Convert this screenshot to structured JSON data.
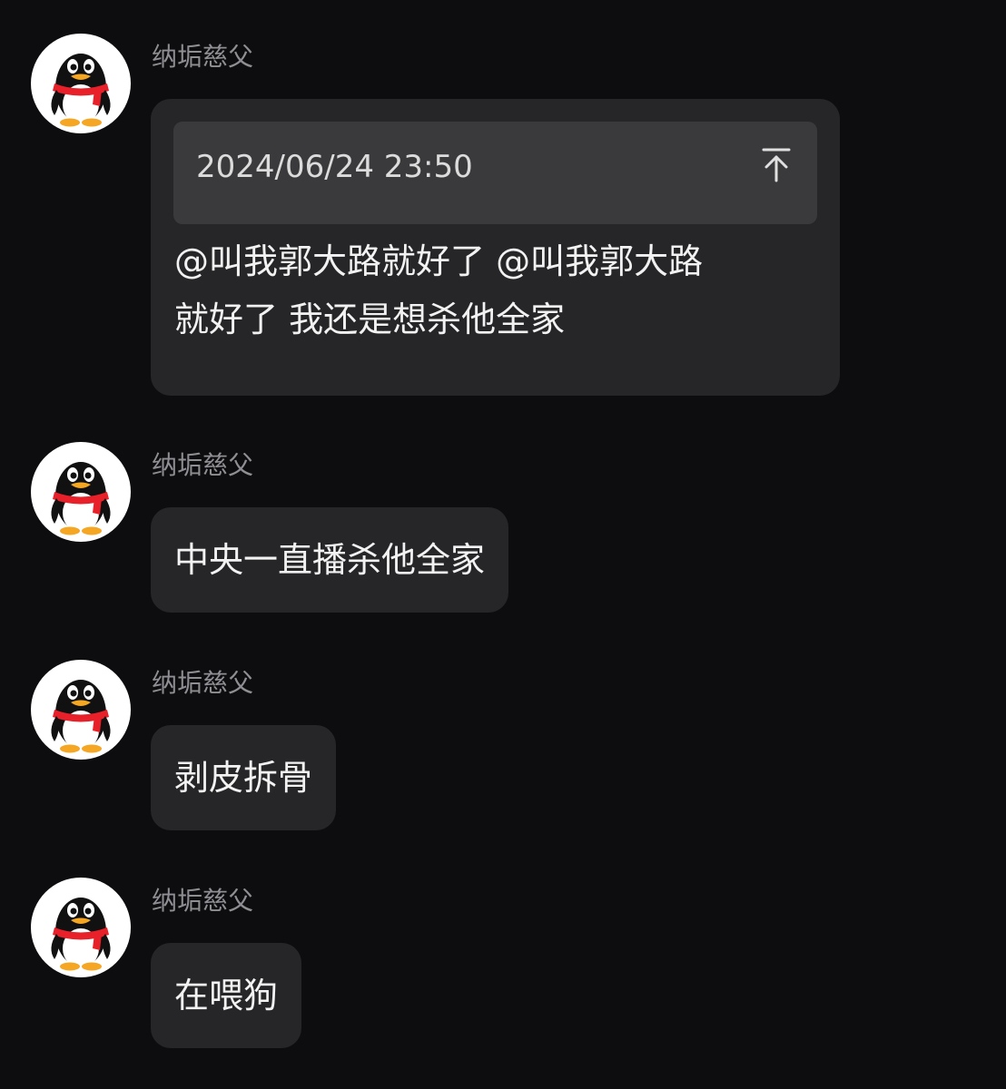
{
  "messages": [
    {
      "sender": "纳垢慈父",
      "avatar_icon": "qq-penguin-icon",
      "reply": {
        "timestamp": "2024/06/24 23:50",
        "icon": "jump-to-top-arrow-icon"
      },
      "lines": [
        "@叫我郭大路就好了 @叫我郭大路",
        "就好了 我还是想杀他全家"
      ]
    },
    {
      "sender": "纳垢慈父",
      "avatar_icon": "qq-penguin-icon",
      "text": "中央一直播杀他全家"
    },
    {
      "sender": "纳垢慈父",
      "avatar_icon": "qq-penguin-icon",
      "text": "剥皮拆骨"
    },
    {
      "sender": "纳垢慈父",
      "avatar_icon": "qq-penguin-icon",
      "text": "在喂狗"
    }
  ],
  "colors": {
    "background": "#0d0d0f",
    "bubble": "#262628",
    "quote_box": "#3a3a3c",
    "sender_name": "#8e8e93",
    "scarf": "#e8202a",
    "beak": "#f5a623"
  }
}
